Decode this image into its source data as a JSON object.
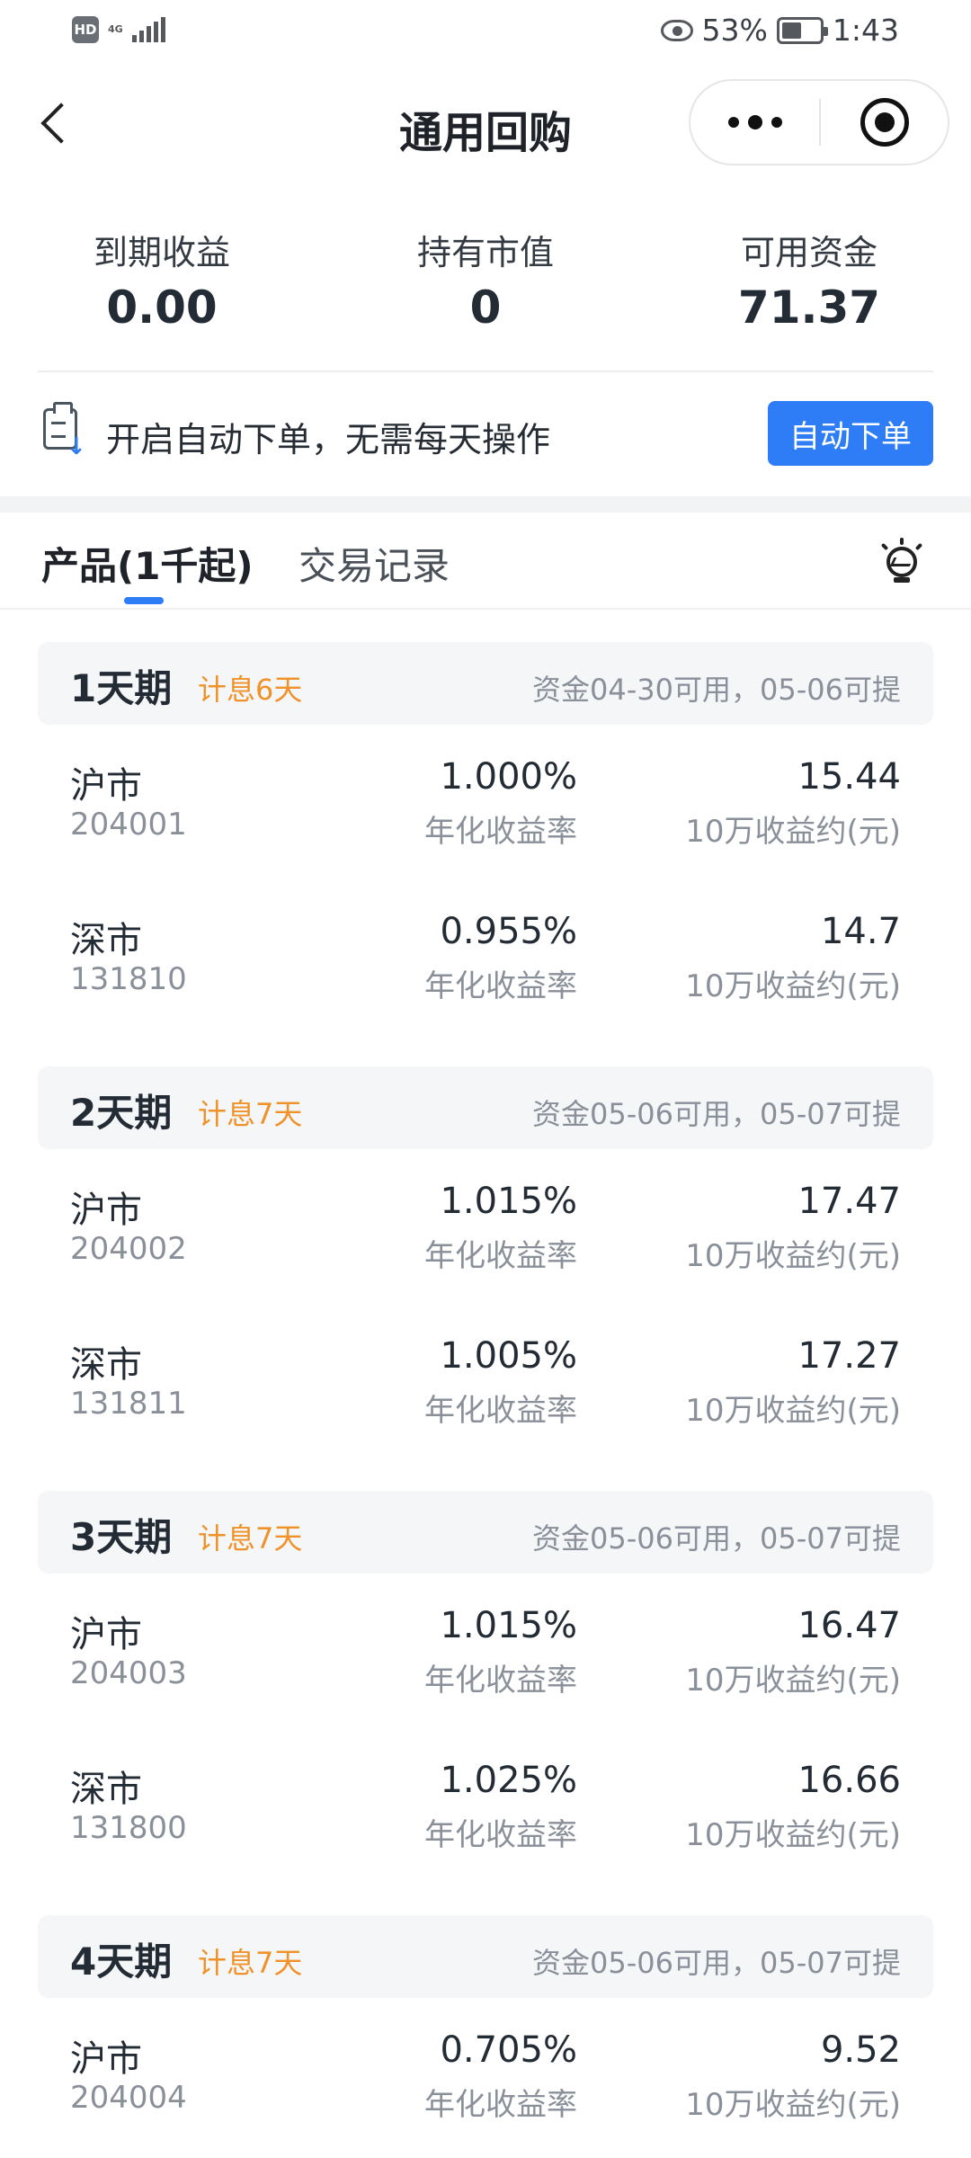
{
  "status_bar": {
    "hd": "HD",
    "network": "4G",
    "battery_percent": "53%",
    "battery_level": 0.53,
    "time": "1:43"
  },
  "nav": {
    "title": "通用回购"
  },
  "summary": [
    {
      "label": "到期收益",
      "value": "0.00"
    },
    {
      "label": "持有市值",
      "value": "0"
    },
    {
      "label": "可用资金",
      "value": "71.37"
    }
  ],
  "auto_order": {
    "text": "开启自动下单，无需每天操作",
    "button": "自动下单"
  },
  "tabs": [
    {
      "label": "产品(1千起)",
      "active": true
    },
    {
      "label": "交易记录",
      "active": false
    }
  ],
  "groups": [
    {
      "period": "1天期",
      "interest": "计息6天",
      "availability": "资金04-30可用，05-06可提",
      "rows": [
        {
          "market": "沪市",
          "code": "204001",
          "rate": "1.000%",
          "rate_label": "年化收益率",
          "earn": "15.44",
          "earn_label": "10万收益约(元)"
        },
        {
          "market": "深市",
          "code": "131810",
          "rate": "0.955%",
          "rate_label": "年化收益率",
          "earn": "14.7",
          "earn_label": "10万收益约(元)"
        }
      ]
    },
    {
      "period": "2天期",
      "interest": "计息7天",
      "availability": "资金05-06可用，05-07可提",
      "rows": [
        {
          "market": "沪市",
          "code": "204002",
          "rate": "1.015%",
          "rate_label": "年化收益率",
          "earn": "17.47",
          "earn_label": "10万收益约(元)"
        },
        {
          "market": "深市",
          "code": "131811",
          "rate": "1.005%",
          "rate_label": "年化收益率",
          "earn": "17.27",
          "earn_label": "10万收益约(元)"
        }
      ]
    },
    {
      "period": "3天期",
      "interest": "计息7天",
      "availability": "资金05-06可用，05-07可提",
      "rows": [
        {
          "market": "沪市",
          "code": "204003",
          "rate": "1.015%",
          "rate_label": "年化收益率",
          "earn": "16.47",
          "earn_label": "10万收益约(元)"
        },
        {
          "market": "深市",
          "code": "131800",
          "rate": "1.025%",
          "rate_label": "年化收益率",
          "earn": "16.66",
          "earn_label": "10万收益约(元)"
        }
      ]
    },
    {
      "period": "4天期",
      "interest": "计息7天",
      "availability": "资金05-06可用，05-07可提",
      "rows": [
        {
          "market": "沪市",
          "code": "204004",
          "rate": "0.705%",
          "rate_label": "年化收益率",
          "earn": "9.52",
          "earn_label": "10万收益约(元)"
        }
      ]
    }
  ]
}
